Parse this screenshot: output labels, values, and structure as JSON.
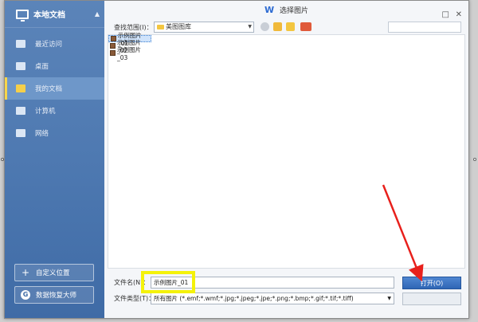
{
  "sidebar": {
    "header_label": "本地文档",
    "collapse_glyph": "▲",
    "items": [
      {
        "label": "最近访问"
      },
      {
        "label": "桌面"
      },
      {
        "label": "我的文档",
        "active": true
      },
      {
        "label": "计算机"
      },
      {
        "label": "网络"
      }
    ],
    "custom_location_label": "自定义位置",
    "recovery_label": "数据恢复大师"
  },
  "dialog": {
    "title": "选择图片",
    "logo": "W",
    "minimize_glyph": "□",
    "close_glyph": "✕"
  },
  "toolbar": {
    "lookin_label": "查找范围(I)：",
    "lookin_value": "美图图库"
  },
  "files": [
    {
      "name": "示例图片_01",
      "selected": true
    },
    {
      "name": "示例图片_02",
      "selected": false
    },
    {
      "name": "示例图片_03",
      "selected": false
    }
  ],
  "bottom": {
    "filename_label": "文件名(N)：",
    "filename_value": "示例图片_01",
    "filetype_label": "文件类型(T)：",
    "filetype_value": "所有图片 (*.emf;*.wmf;*.jpg;*.jpeg;*.jpe;*.png;*.bmp;*.gif;*.tif;*.tiff)",
    "open_label": "打开(O)"
  },
  "colors": {
    "sidebar_blue": "#4e79b1",
    "highlight_yellow": "#f4f20a",
    "arrow_red": "#e8201c",
    "open_button_blue": "#3a72c2"
  }
}
